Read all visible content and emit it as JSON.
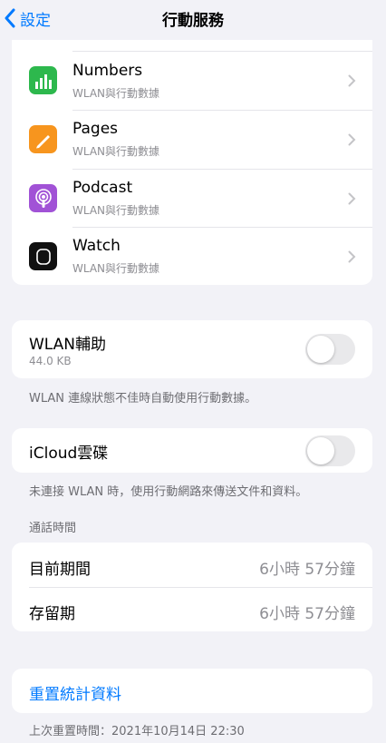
{
  "nav": {
    "back_label": "設定",
    "title": "行動服務"
  },
  "apps": [
    {
      "name": "Numbers",
      "subtitle": "WLAN與行動數據",
      "icon": "numbers-icon",
      "color": "#2db84d"
    },
    {
      "name": "Pages",
      "subtitle": "WLAN與行動數據",
      "icon": "pages-icon",
      "color": "#f7951e"
    },
    {
      "name": "Podcast",
      "subtitle": "WLAN與行動數據",
      "icon": "podcast-icon",
      "color": "#a152d6"
    },
    {
      "name": "Watch",
      "subtitle": "WLAN與行動數據",
      "icon": "watch-icon",
      "color": "#111111"
    }
  ],
  "wlan_assist": {
    "title": "WLAN輔助",
    "usage": "44.0 KB",
    "enabled": false,
    "footnote": "WLAN 連線狀態不佳時自動使用行動數據。"
  },
  "icloud_drive": {
    "title": "iCloud雲碟",
    "enabled": false,
    "footnote": "未連接 WLAN 時，使用行動網路來傳送文件和資料。"
  },
  "call_time": {
    "header": "通話時間",
    "rows": [
      {
        "label": "目前期間",
        "value": "6小時 57分鐘"
      },
      {
        "label": "存留期",
        "value": "6小時 57分鐘"
      }
    ]
  },
  "reset": {
    "label": "重置統計資料",
    "last_reset": "上次重置時間：2021年10月14日 22:30"
  },
  "colors": {
    "accent": "#007aff",
    "background": "#f2f2f7"
  }
}
